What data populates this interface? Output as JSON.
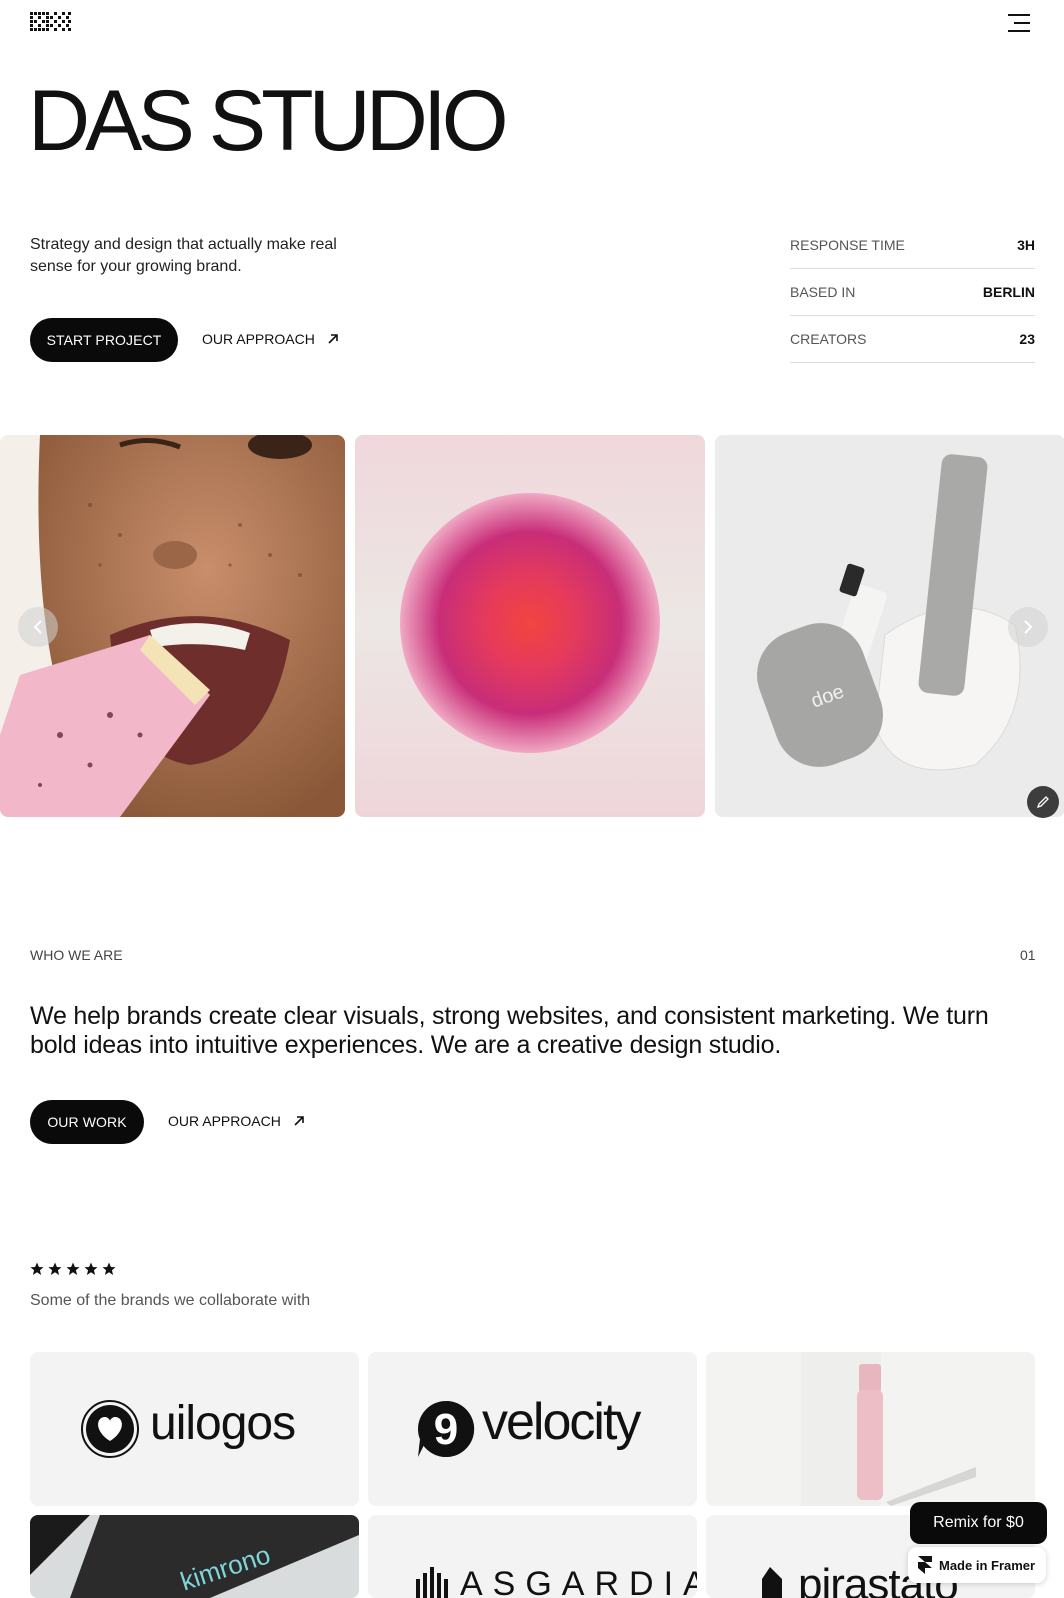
{
  "header": {
    "logo_icon": "pixel-grid-logo-icon",
    "menu_icon": "hamburger-menu-icon"
  },
  "hero": {
    "title": "DAS STUDIO",
    "tagline": "Strategy and design that actually make real sense for your growing brand.",
    "primary_button": "START PROJECT",
    "secondary_link": "OUR APPROACH"
  },
  "stats": [
    {
      "label": "RESPONSE TIME",
      "value": "3H"
    },
    {
      "label": "BASED IN",
      "value": "BERLIN"
    },
    {
      "label": "CREATORS",
      "value": "23"
    }
  ],
  "gallery": {
    "prev_icon": "chevron-left-icon",
    "next_icon": "chevron-right-icon",
    "edit_icon": "pencil-icon",
    "product_brand": "doe"
  },
  "who_we_are": {
    "label": "WHO WE ARE",
    "number": "01",
    "lead": "We help brands create clear visuals, strong websites, and consistent marketing. We turn bold ideas into intuitive experiences. We are a creative design studio.",
    "primary_button": "OUR WORK",
    "secondary_link": "OUR APPROACH"
  },
  "brands": {
    "rating_stars": 5,
    "caption": "Some of the brands we collaborate with",
    "logos": [
      "uilogos",
      "velocity",
      "kimrono",
      "ASGARDIA",
      "pirastato"
    ]
  },
  "overlay": {
    "remix_label": "Remix for $0",
    "framer_label": "Made in Framer"
  }
}
